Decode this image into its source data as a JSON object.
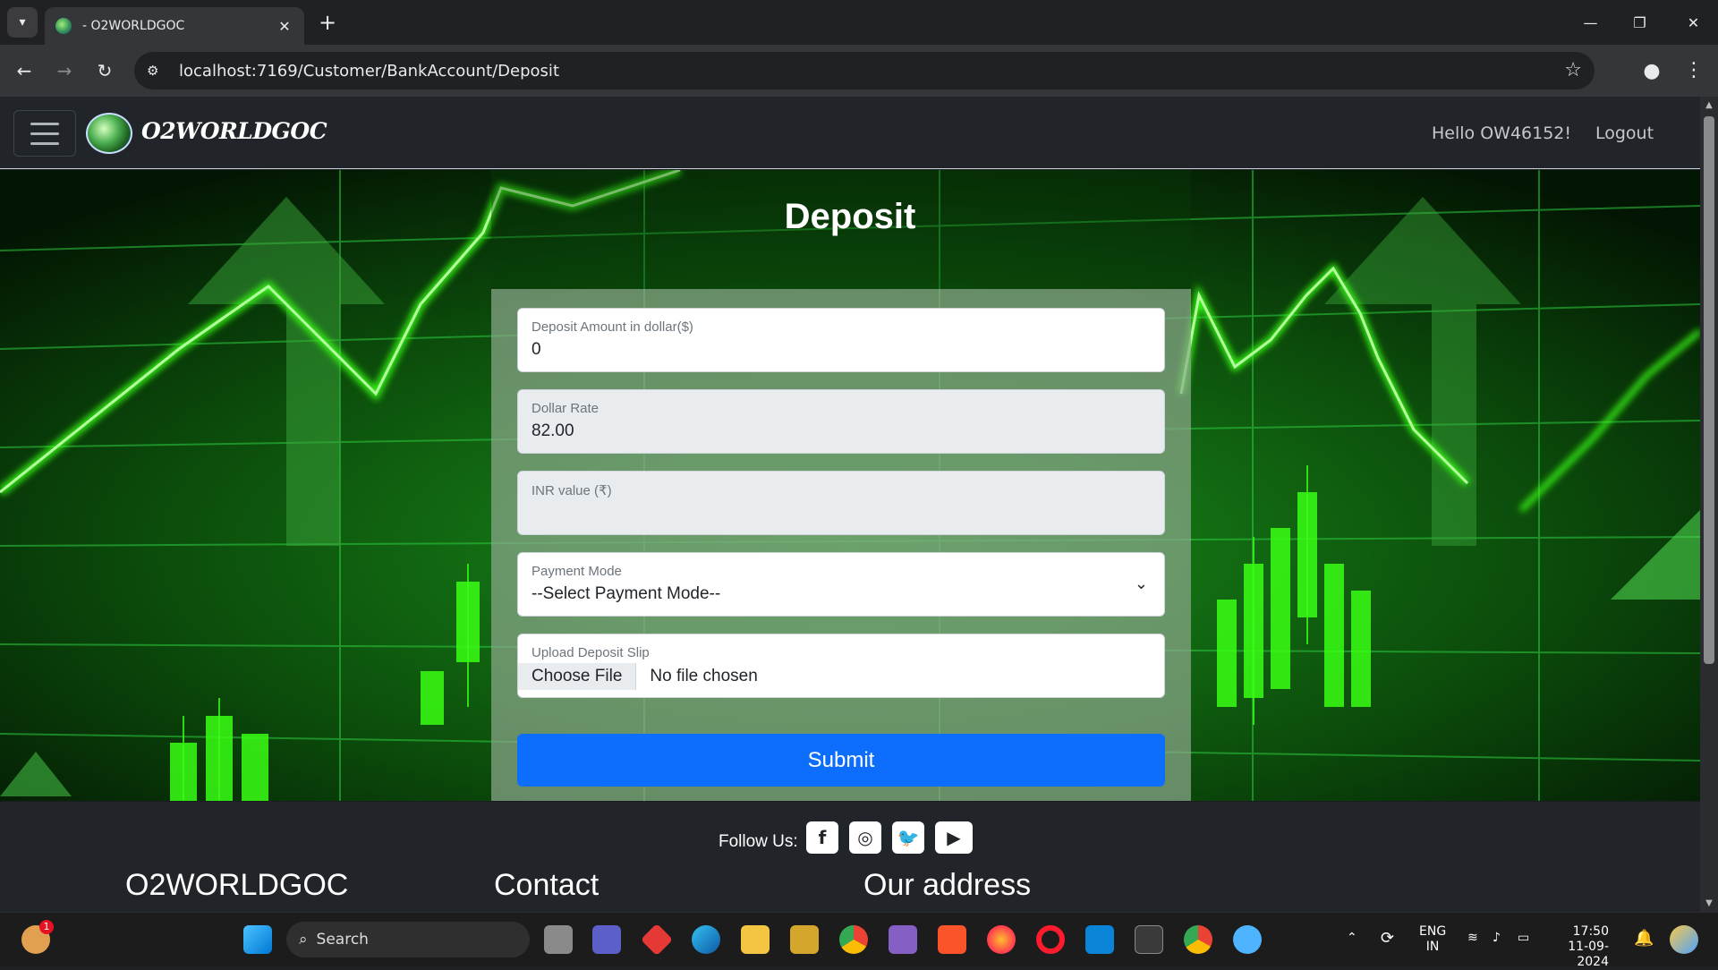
{
  "browser": {
    "tab_title": "- O2WORLDGOC",
    "url": "localhost:7169/Customer/BankAccount/Deposit"
  },
  "site": {
    "brand": "O2WORLDGOC",
    "greeting": "Hello OW46152!",
    "logout_label": "Logout"
  },
  "page": {
    "title": "Deposit"
  },
  "form": {
    "deposit_amount": {
      "label": "Deposit Amount in dollar($)",
      "value": "0"
    },
    "dollar_rate": {
      "label": "Dollar Rate",
      "value": "82.00"
    },
    "inr_value": {
      "label": "INR value (₹)",
      "value": ""
    },
    "payment_mode": {
      "label": "Payment Mode",
      "value": "--Select Payment Mode--"
    },
    "upload": {
      "label": "Upload Deposit Slip",
      "button": "Choose File",
      "status": "No file chosen"
    },
    "submit_label": "Submit"
  },
  "footer": {
    "follow_label": "Follow Us:",
    "social": [
      "facebook-icon",
      "instagram-icon",
      "twitter-icon",
      "youtube-icon"
    ],
    "headings": {
      "brand": "O2WORLDGOC",
      "contact": "Contact",
      "address": "Our address"
    }
  },
  "taskbar": {
    "search_placeholder": "Search",
    "notification_count": "1",
    "lang_top": "ENG",
    "lang_bottom": "IN",
    "time": "17:50",
    "date": "11-09-2024"
  },
  "colors": {
    "primary": "#0d6efd",
    "navbar": "#212529",
    "chart_green": "#39ff14"
  }
}
